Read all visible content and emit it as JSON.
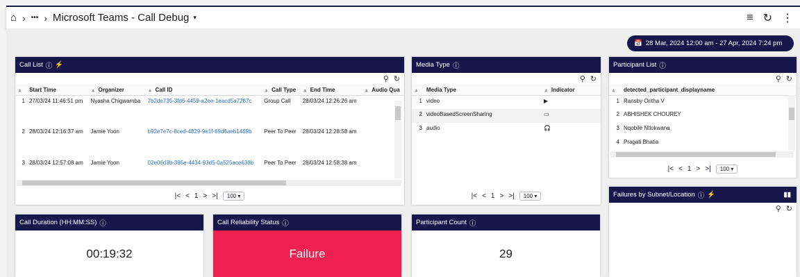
{
  "breadcrumb": {
    "home_icon": "home-icon",
    "ellipsis": "•••",
    "title": "Microsoft Teams - Call Debug"
  },
  "topbar": {
    "filter_icon": "filter-icon",
    "refresh_icon": "refresh-icon",
    "more_icon": "more-vertical-icon"
  },
  "date_range": {
    "label": "28 Mar, 2024 12:00 am - 27 Apr, 2024 7:24 pm"
  },
  "call_list": {
    "title": "Call List",
    "columns": [
      "Start Time",
      "Organizer",
      "Call ID",
      "Call Type",
      "End Time",
      "Audio Qua"
    ],
    "rows": [
      {
        "num": "1",
        "start": "27/03/24 11:46:51 pm",
        "organizer": "Nyasha Chigwamba",
        "callid": "7b2de735-3fd6-4459-a2ee-1eacd5a7287c",
        "type": "Group Call",
        "end": "28/03/24 12:26:26 am"
      },
      {
        "num": "2",
        "start": "28/03/24 12:16:37 am",
        "organizer": "Jamie Yoon",
        "callid": "b92e7e7c-8ced-4829-9e1f-69d6aeb1469b",
        "type": "Peer To Peer",
        "end": "28/03/24 12:28:58 am"
      },
      {
        "num": "3",
        "start": "28/03/24 12:57:08 am",
        "organizer": "Jamie Yoon",
        "callid": "02e06d3b-395e-4434-93d5-0a525ace638b",
        "type": "Peer To Peer",
        "end": "28/03/24 12:58:38 am"
      }
    ],
    "pager": {
      "page": "1",
      "size": "100"
    }
  },
  "media_type": {
    "title": "Media Type",
    "columns": [
      "Media Type",
      "Indicator"
    ],
    "rows": [
      {
        "num": "1",
        "media": "video",
        "indicator": "▶"
      },
      {
        "num": "2",
        "media": "videoBasedScreenSharing",
        "indicator": "▭"
      },
      {
        "num": "3",
        "media": "audio",
        "indicator": "🎧"
      }
    ],
    "pager": {
      "page": "1",
      "size": "100"
    }
  },
  "participant_list": {
    "title": "Participant List",
    "columns": [
      "detected_participant_displayname"
    ],
    "rows": [
      {
        "num": "1",
        "name": "Ransby Oritha V"
      },
      {
        "num": "2",
        "name": "ABHISHEK CHOUREY"
      },
      {
        "num": "3",
        "name": "Nqobile Ntlokwana"
      },
      {
        "num": "4",
        "name": "Pragati Bhatia"
      }
    ],
    "pager": {
      "page": "1",
      "size": "100"
    }
  },
  "failures": {
    "title": "Failures by Subnet/Location"
  },
  "call_duration": {
    "title": "Call Duration (HH:MM:SS)",
    "value": "00:19:32"
  },
  "call_reliability": {
    "title": "Call Reliability Status",
    "value": "Failure"
  },
  "participant_count": {
    "title": "Participant Count",
    "value": "29"
  },
  "colors": {
    "header": "#16164a",
    "failure": "#f0214f",
    "link": "#2b6fc2"
  }
}
